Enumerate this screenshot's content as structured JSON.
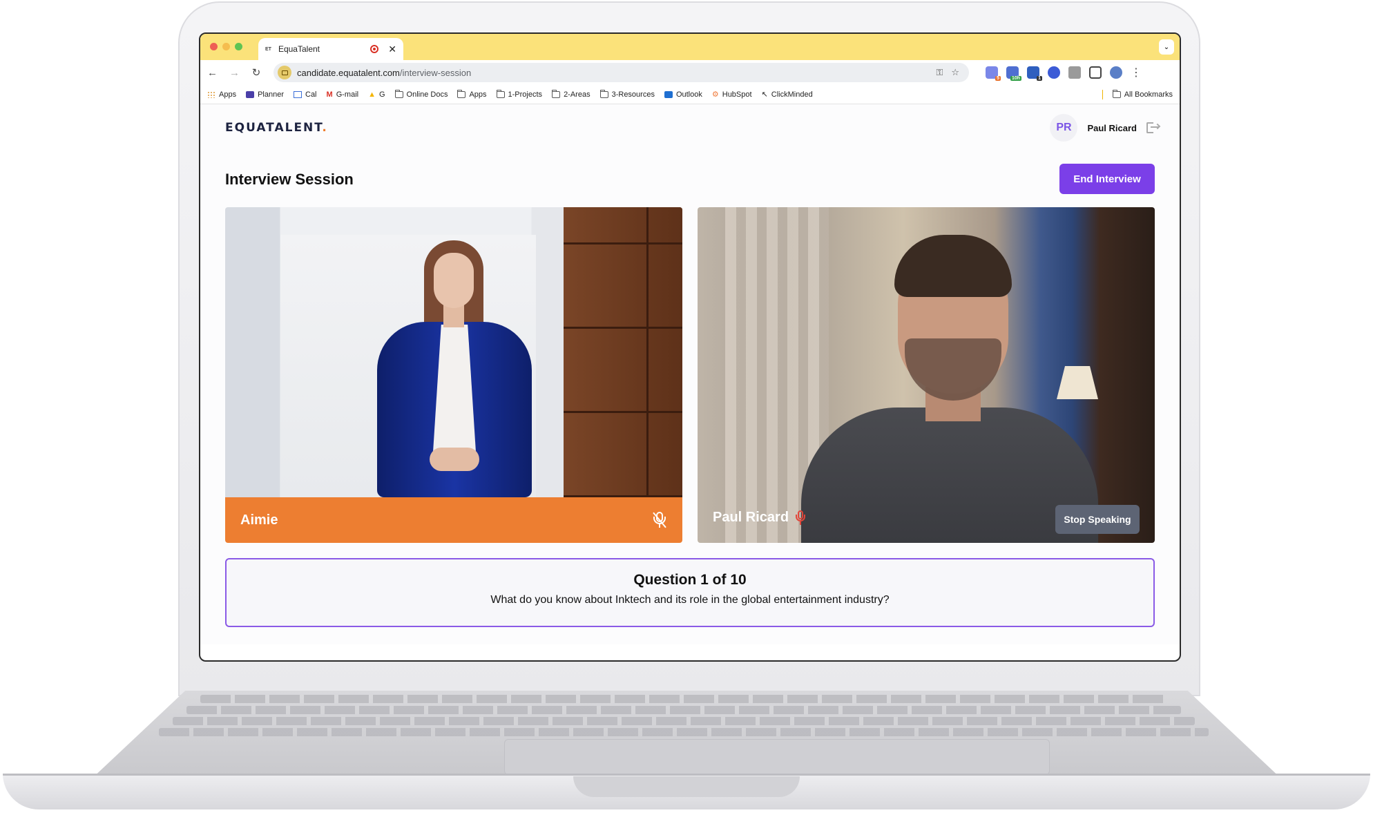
{
  "browser": {
    "tab_title": "EquaTalent",
    "tab_favicon": "ET",
    "url_domain": "candidate.equatalent.com",
    "url_path": "/interview-session",
    "bookmarks": [
      {
        "label": "Apps",
        "icon": "grid-icon"
      },
      {
        "label": "Planner",
        "icon": "planner-icon"
      },
      {
        "label": "Cal",
        "icon": "calendar-icon"
      },
      {
        "label": "G-mail",
        "icon": "gmail-icon"
      },
      {
        "label": "G",
        "icon": "drive-icon"
      },
      {
        "label": "Online Docs",
        "icon": "folder-icon"
      },
      {
        "label": "Apps",
        "icon": "folder-icon"
      },
      {
        "label": "1-Projects",
        "icon": "folder-icon"
      },
      {
        "label": "2-Areas",
        "icon": "folder-icon"
      },
      {
        "label": "3-Resources",
        "icon": "folder-icon"
      },
      {
        "label": "Outlook",
        "icon": "outlook-icon"
      },
      {
        "label": "HubSpot",
        "icon": "hubspot-icon"
      },
      {
        "label": "ClickMinded",
        "icon": "cursor-icon"
      }
    ],
    "all_bookmarks": "All Bookmarks",
    "extension_badges": {
      "first": "5",
      "second": "10h",
      "third": "1"
    }
  },
  "app": {
    "logo_text": "EQUATALENT",
    "logo_dot": ".",
    "user_initials": "PR",
    "user_name": "Paul Ricard",
    "page_title": "Interview Session",
    "end_interview_label": "End Interview",
    "left_participant": "Aimie",
    "right_participant": "Paul Ricard",
    "stop_speaking_label": "Stop Speaking",
    "question_title": "Question 1 of 10",
    "question_text": "What do you know about Inktech and its role in the global entertainment industry?"
  },
  "colors": {
    "accent": "#7b3fe8",
    "tab_strip": "#fbe27a",
    "speaker_bar": "#ed7e31",
    "mic_active": "#e2463a"
  }
}
